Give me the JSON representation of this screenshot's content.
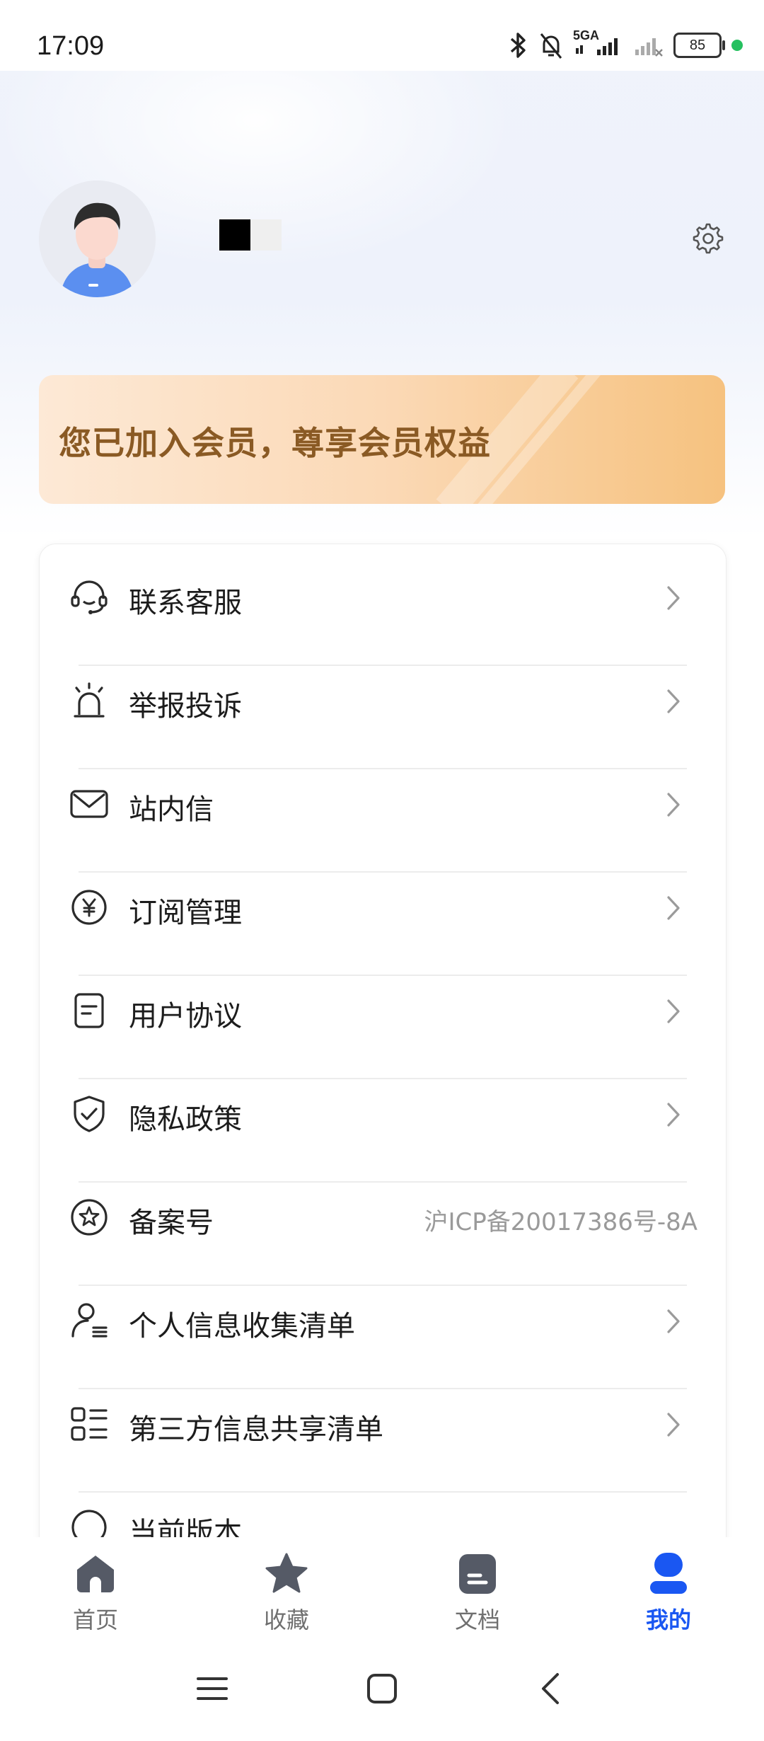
{
  "status_bar": {
    "time": "17:09",
    "network": "5GA",
    "battery": "85",
    "icons": [
      "bluetooth-icon",
      "mute-bell-icon",
      "signal-icon",
      "signal-weak-icon",
      "battery-icon"
    ]
  },
  "profile": {
    "avatar": "avatar",
    "settings_icon": "gear-icon"
  },
  "member_banner": {
    "text": "您已加入会员，尊享会员权益"
  },
  "menu": {
    "items": [
      {
        "label": "联系客服",
        "icon": "headset-icon"
      },
      {
        "label": "举报投诉",
        "icon": "alarm-icon"
      },
      {
        "label": "站内信",
        "icon": "mail-icon"
      },
      {
        "label": "订阅管理",
        "icon": "yuan-icon"
      },
      {
        "label": "用户协议",
        "icon": "document-icon"
      },
      {
        "label": "隐私政策",
        "icon": "shield-check-icon"
      },
      {
        "label": "备案号",
        "icon": "star-badge-icon",
        "value": "沪ICP备20017386号-8A"
      },
      {
        "label": "个人信息收集清单",
        "icon": "user-list-icon"
      },
      {
        "label": "第三方信息共享清单",
        "icon": "grid-list-icon"
      },
      {
        "label": "当前版本",
        "icon": "info-icon"
      }
    ]
  },
  "tab_bar": {
    "tabs": [
      {
        "label": "首页",
        "icon": "home-icon",
        "active": false
      },
      {
        "label": "收藏",
        "icon": "star-icon",
        "active": false
      },
      {
        "label": "文档",
        "icon": "doc-icon",
        "active": false
      },
      {
        "label": "我的",
        "icon": "person-icon",
        "active": true
      }
    ]
  },
  "colors": {
    "accent": "#1a57f2",
    "member_text": "#8a5a24",
    "banner_start": "#fde9d6",
    "banner_end": "#f6c27f",
    "status_dot": "#25c05f"
  }
}
